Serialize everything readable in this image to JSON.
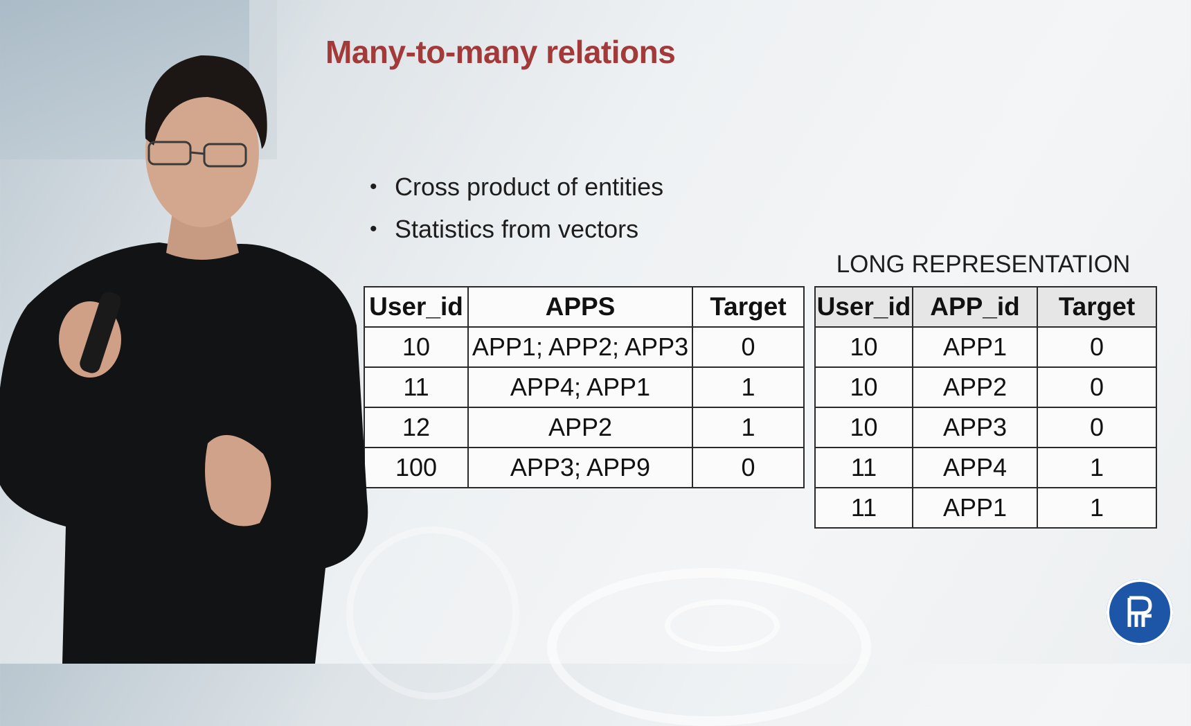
{
  "slide": {
    "title": "Many-to-many relations",
    "bullets": [
      "Cross product of entities",
      "Statistics from vectors"
    ],
    "bullet_glyph": "•"
  },
  "wide_table": {
    "headers": [
      "User_id",
      "APPS",
      "Target"
    ],
    "rows": [
      [
        "10",
        "APP1; APP2; APP3",
        "0"
      ],
      [
        "11",
        "APP4; APP1",
        "1"
      ],
      [
        "12",
        "APP2",
        "1"
      ],
      [
        "100",
        "APP3; APP9",
        "0"
      ]
    ]
  },
  "long_table": {
    "caption": "LONG REPRESENTATION",
    "headers": [
      "User_id",
      "APP_id",
      "Target"
    ],
    "rows": [
      [
        "10",
        "APP1",
        "0"
      ],
      [
        "10",
        "APP2",
        "0"
      ],
      [
        "10",
        "APP3",
        "0"
      ],
      [
        "11",
        "APP4",
        "1"
      ],
      [
        "11",
        "APP1",
        "1"
      ]
    ]
  },
  "colors": {
    "title": "#a33a3a",
    "logo": "#1d56a7"
  },
  "icons": {
    "logo": "university-logo-icon"
  }
}
